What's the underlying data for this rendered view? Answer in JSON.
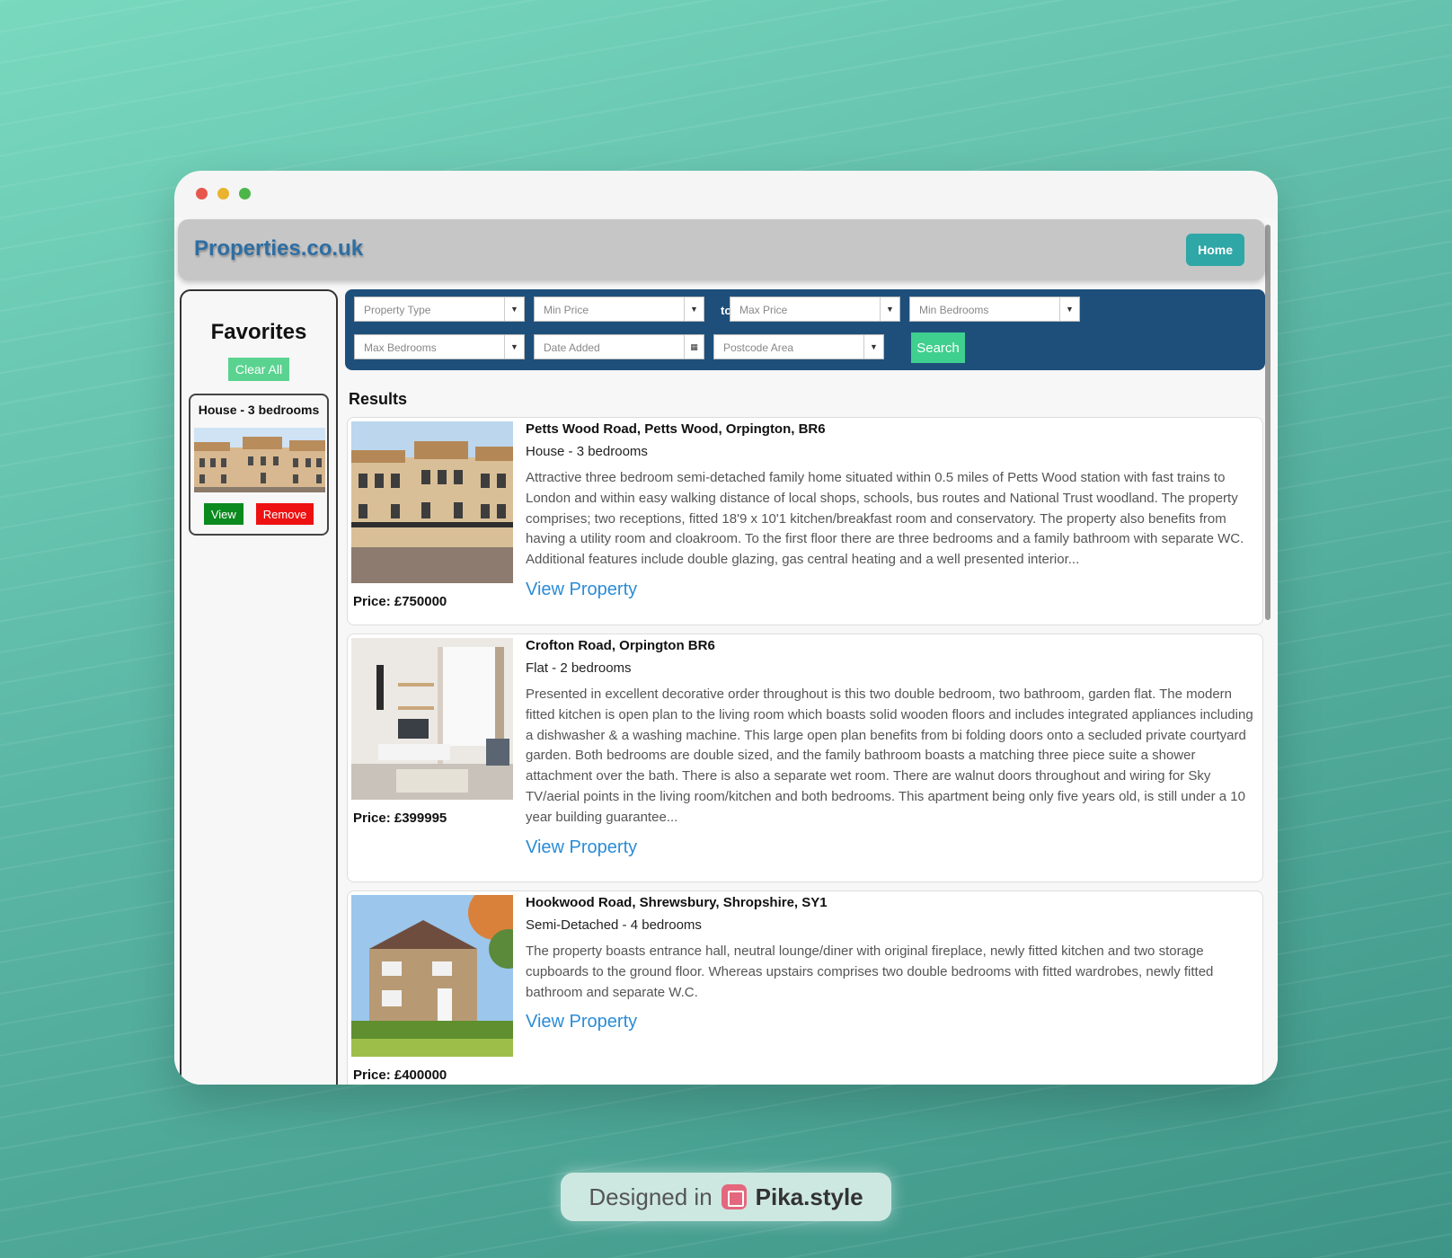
{
  "site": {
    "logo": "Properties.co.uk",
    "home_label": "Home"
  },
  "favorites": {
    "title": "Favorites",
    "clear_label": "Clear All",
    "items": [
      {
        "name": "House - 3 bedrooms",
        "view_label": "View",
        "remove_label": "Remove"
      }
    ]
  },
  "search": {
    "property_type": "Property Type",
    "min_price": "Min Price",
    "to_label": "to",
    "max_price": "Max Price",
    "min_bedrooms": "Min Bedrooms",
    "max_bedrooms": "Max Bedrooms",
    "date_added": "Date Added",
    "postcode_area": "Postcode Area",
    "search_label": "Search"
  },
  "results": {
    "title": "Results",
    "items": [
      {
        "address": "Petts Wood Road, Petts Wood, Orpington, BR6",
        "type": "House - 3 bedrooms",
        "description": "Attractive three bedroom semi-detached family home situated within 0.5 miles of Petts Wood station with fast trains to London and within easy walking distance of local shops, schools, bus routes and National Trust woodland. The property comprises; two receptions, fitted 18'9 x 10'1 kitchen/breakfast room and conservatory. The property also benefits from having a utility room and cloakroom. To the first floor there are three bedrooms and a family bathroom with separate WC. Additional features include double glazing, gas central heating and a well presented interior...",
        "price": "Price: £750000",
        "link_label": "View Property"
      },
      {
        "address": "Crofton Road, Orpington BR6",
        "type": "Flat - 2 bedrooms",
        "description": "Presented in excellent decorative order throughout is this two double bedroom, two bathroom, garden flat. The modern fitted kitchen is open plan to the living room which boasts solid wooden floors and includes integrated appliances including a dishwasher & a washing machine. This large open plan benefits from bi folding doors onto a secluded private courtyard garden. Both bedrooms are double sized, and the family bathroom boasts a matching three piece suite a shower attachment over the bath. There is also a separate wet room. There are walnut doors throughout and wiring for Sky TV/aerial points in the living room/kitchen and both bedrooms. This apartment being only five years old, is still under a 10 year building guarantee...",
        "price": "Price: £399995",
        "link_label": "View Property"
      },
      {
        "address": "Hookwood Road, Shrewsbury, Shropshire, SY1",
        "type": "Semi-Detached - 4 bedrooms",
        "description": "The property boasts entrance hall, neutral lounge/diner with original fireplace, newly fitted kitchen and two storage cupboards to the ground floor. Whereas upstairs comprises two double bedrooms with fitted wardrobes, newly fitted bathroom and separate W.C.",
        "price": "Price: £400000",
        "link_label": "View Property"
      }
    ]
  },
  "footer": {
    "designed_in": "Designed in",
    "brand": "Pika.style"
  }
}
